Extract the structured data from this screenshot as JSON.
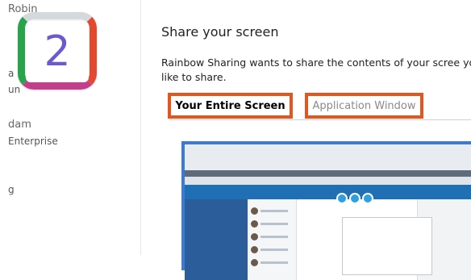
{
  "sidebar": {
    "fragments": [
      "Robin",
      "a",
      "un",
      "dam",
      "Enterprise",
      "g"
    ]
  },
  "badge": {
    "number": "2"
  },
  "dialog": {
    "title": "Share your screen",
    "description": "Rainbow Sharing wants to share the contents of your scree you'd like to share.",
    "tabs": [
      {
        "label": "Your Entire Screen",
        "active": true
      },
      {
        "label": "Application Window",
        "active": false
      }
    ]
  },
  "colors": {
    "highlight": "#e4561f",
    "preview_border": "#3a7bd5",
    "badge_number": "#6a5acd"
  }
}
